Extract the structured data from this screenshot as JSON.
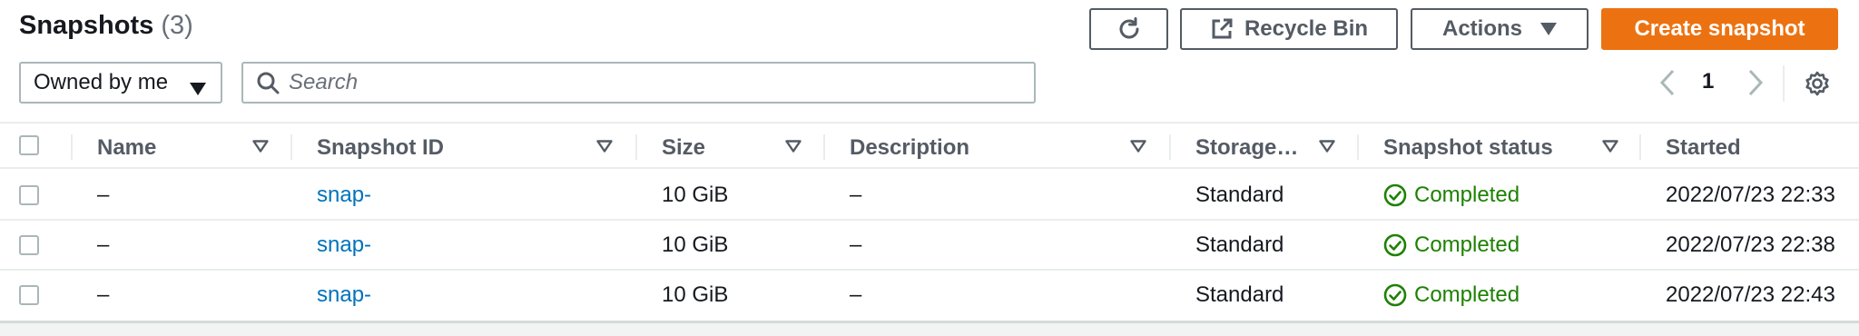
{
  "header": {
    "title": "Snapshots",
    "count": "(3)"
  },
  "toolbar": {
    "refresh_icon": "refresh-icon",
    "recycle_bin_label": "Recycle Bin",
    "recycle_bin_icon": "external-link-icon",
    "actions_label": "Actions",
    "create_label": "Create snapshot",
    "accent_color": "#ec7211"
  },
  "filter": {
    "owner_selected": "Owned by me",
    "search_placeholder": "Search"
  },
  "pagination": {
    "current_page": "1"
  },
  "table": {
    "columns": [
      "Name",
      "Snapshot ID",
      "Size",
      "Description",
      "Storage…",
      "Snapshot status",
      "Started"
    ],
    "rows": [
      {
        "name": "–",
        "snapshot_id": "snap-",
        "size": "10 GiB",
        "description": "–",
        "storage": "Standard",
        "status": "Completed",
        "started": "2022/07/23 22:33"
      },
      {
        "name": "–",
        "snapshot_id": "snap-",
        "size": "10 GiB",
        "description": "–",
        "storage": "Standard",
        "status": "Completed",
        "started": "2022/07/23 22:38"
      },
      {
        "name": "–",
        "snapshot_id": "snap-",
        "size": "10 GiB",
        "description": "–",
        "storage": "Standard",
        "status": "Completed",
        "started": "2022/07/23 22:43"
      }
    ],
    "status_color": "#1d8102",
    "link_color": "#0073bb"
  }
}
